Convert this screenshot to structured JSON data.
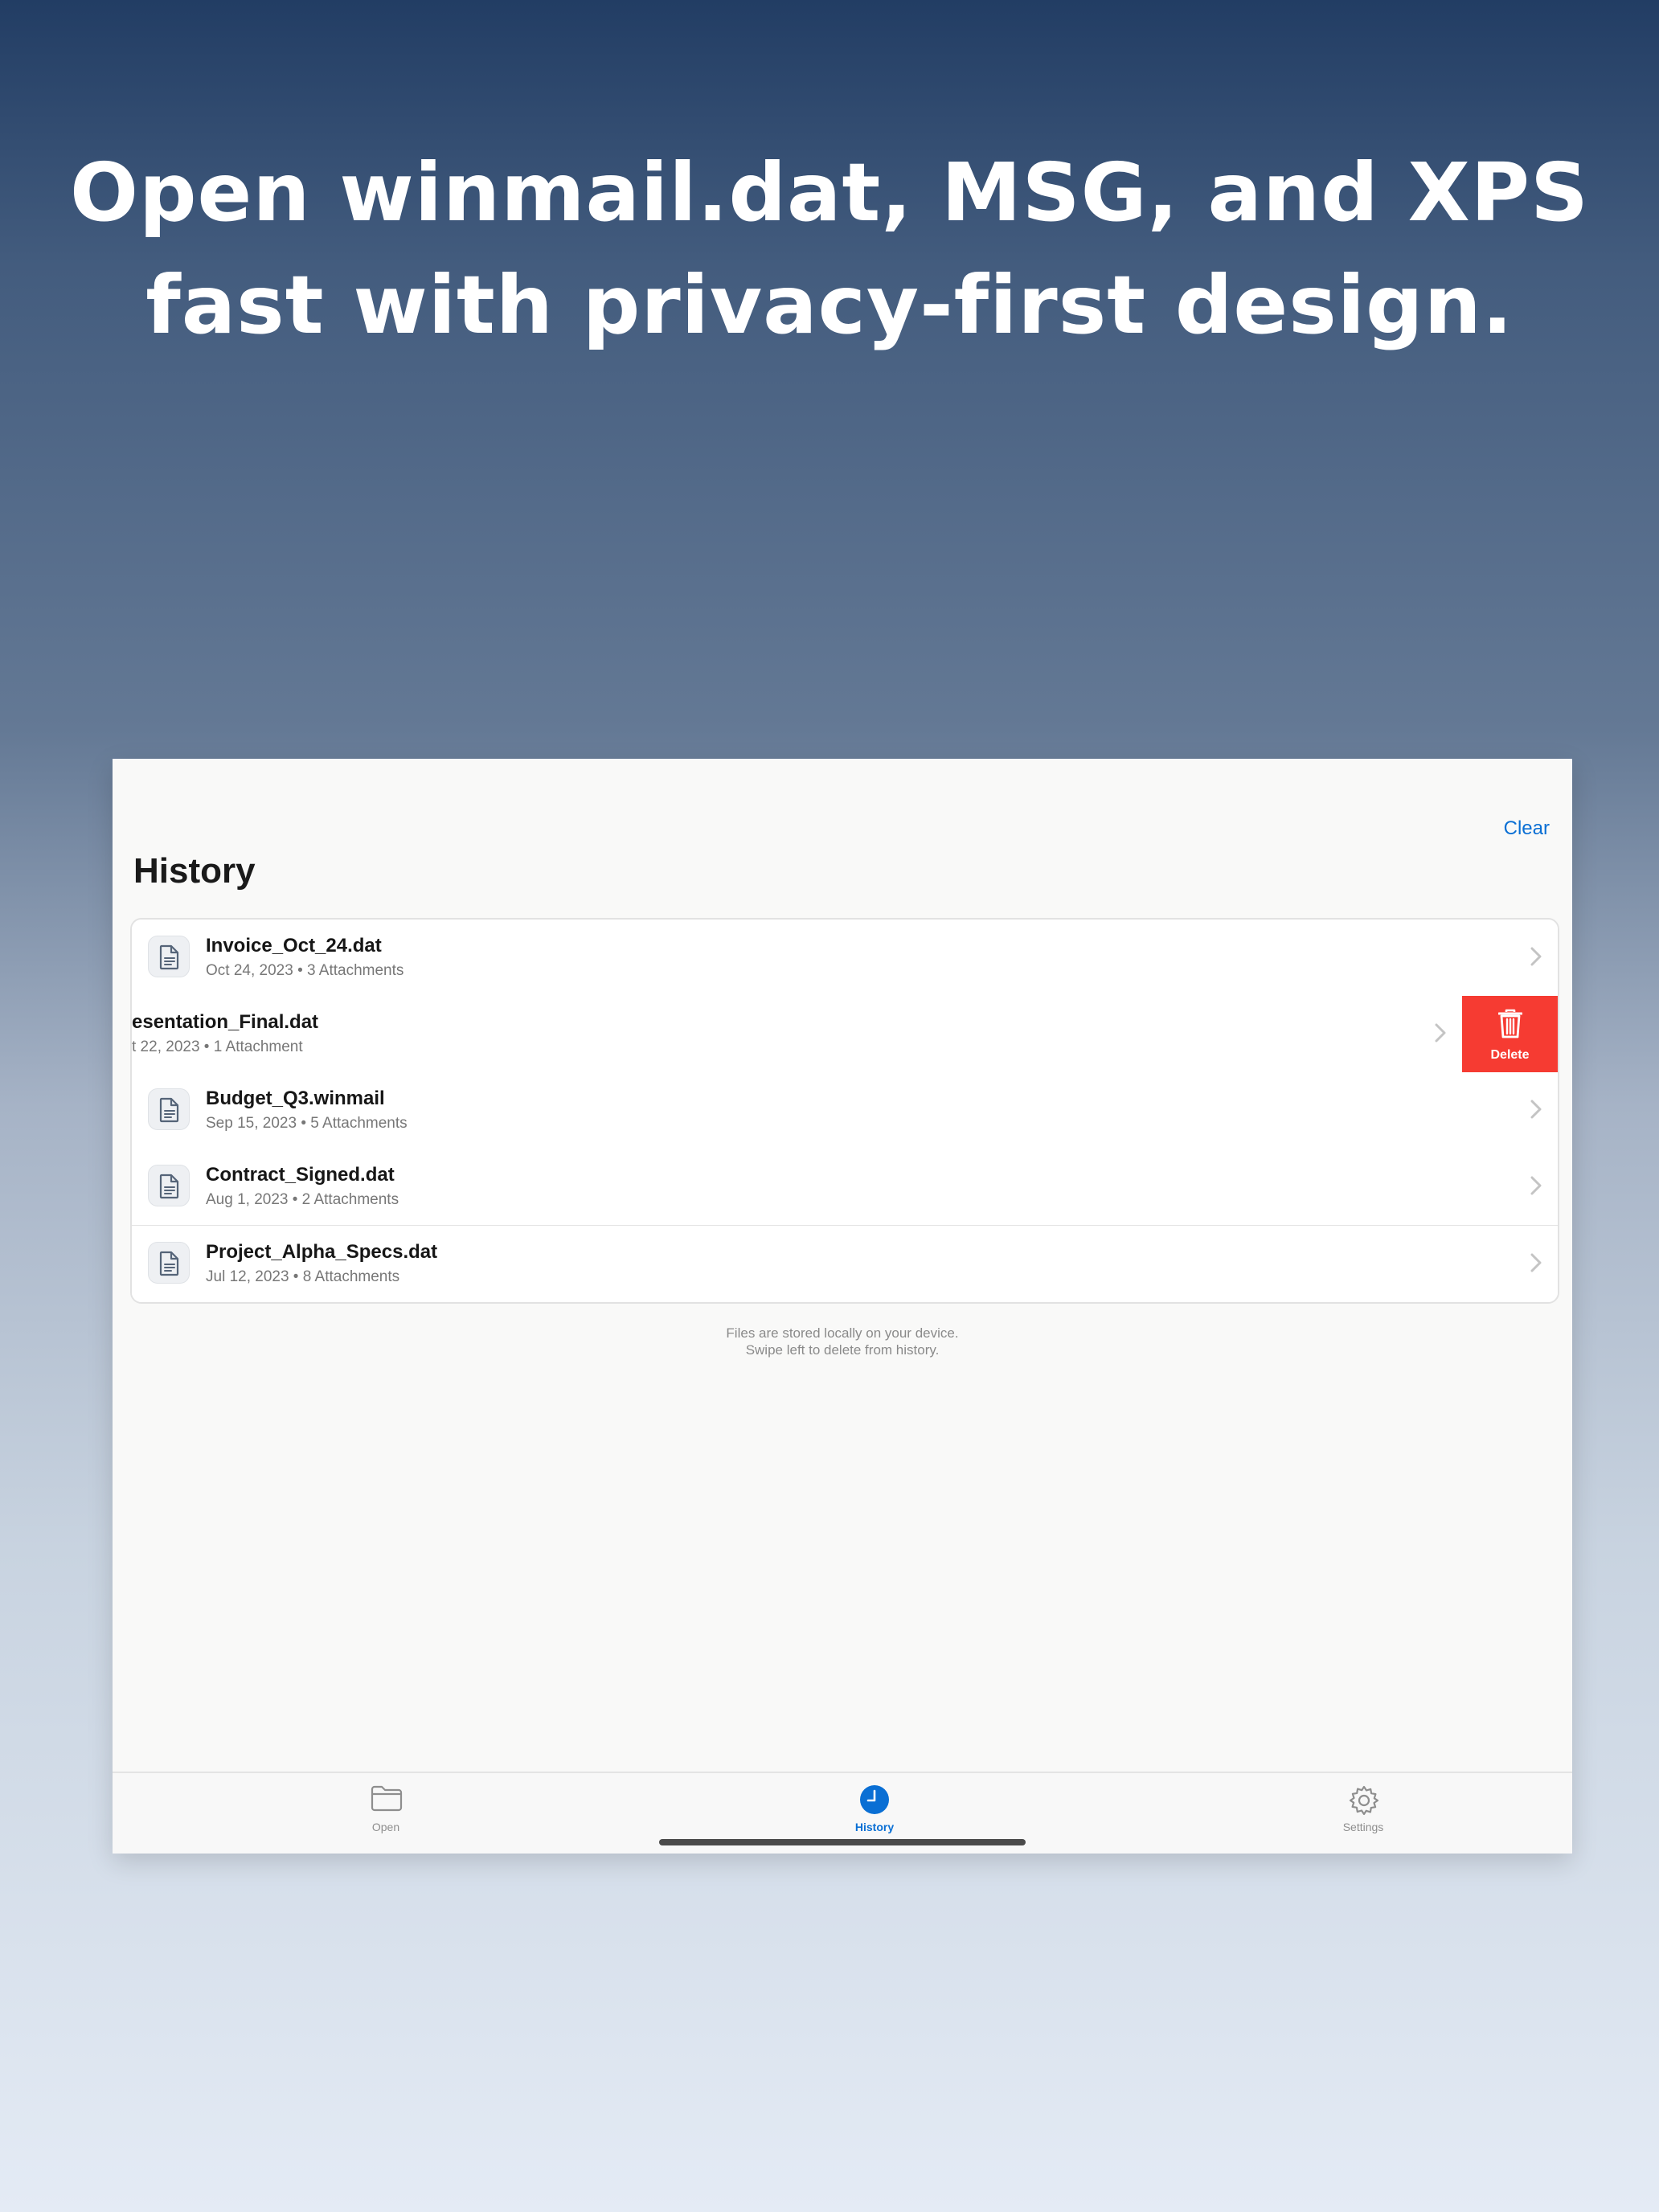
{
  "headline": {
    "line1": "Open winmail.dat, MSG, and XPS",
    "line2": "fast with privacy-first design."
  },
  "header": {
    "clear_label": "Clear",
    "title": "History"
  },
  "history_items": [
    {
      "name": "Invoice_Oct_24.dat",
      "meta": "Oct 24, 2023 • 3 Attachments"
    },
    {
      "name": "esentation_Final.dat",
      "meta": "t 22, 2023 • 1 Attachment"
    },
    {
      "name": "Budget_Q3.winmail",
      "meta": "Sep 15, 2023 • 5 Attachments"
    },
    {
      "name": "Contract_Signed.dat",
      "meta": "Aug 1, 2023 • 2 Attachments"
    },
    {
      "name": "Project_Alpha_Specs.dat",
      "meta": "Jul 12, 2023 • 8 Attachments"
    }
  ],
  "swipe_action": {
    "label": "Delete",
    "icon": "trash-icon",
    "color": "#f63b32"
  },
  "footer_note": {
    "line1": "Files are stored locally on your device.",
    "line2": "Swipe left to delete from history."
  },
  "tabs": [
    {
      "label": "Open",
      "icon": "folder-icon"
    },
    {
      "label": "History",
      "icon": "clock-icon"
    },
    {
      "label": "Settings",
      "icon": "gear-icon"
    }
  ],
  "colors": {
    "accent": "#0a6fd4",
    "destructive": "#f63b32"
  }
}
